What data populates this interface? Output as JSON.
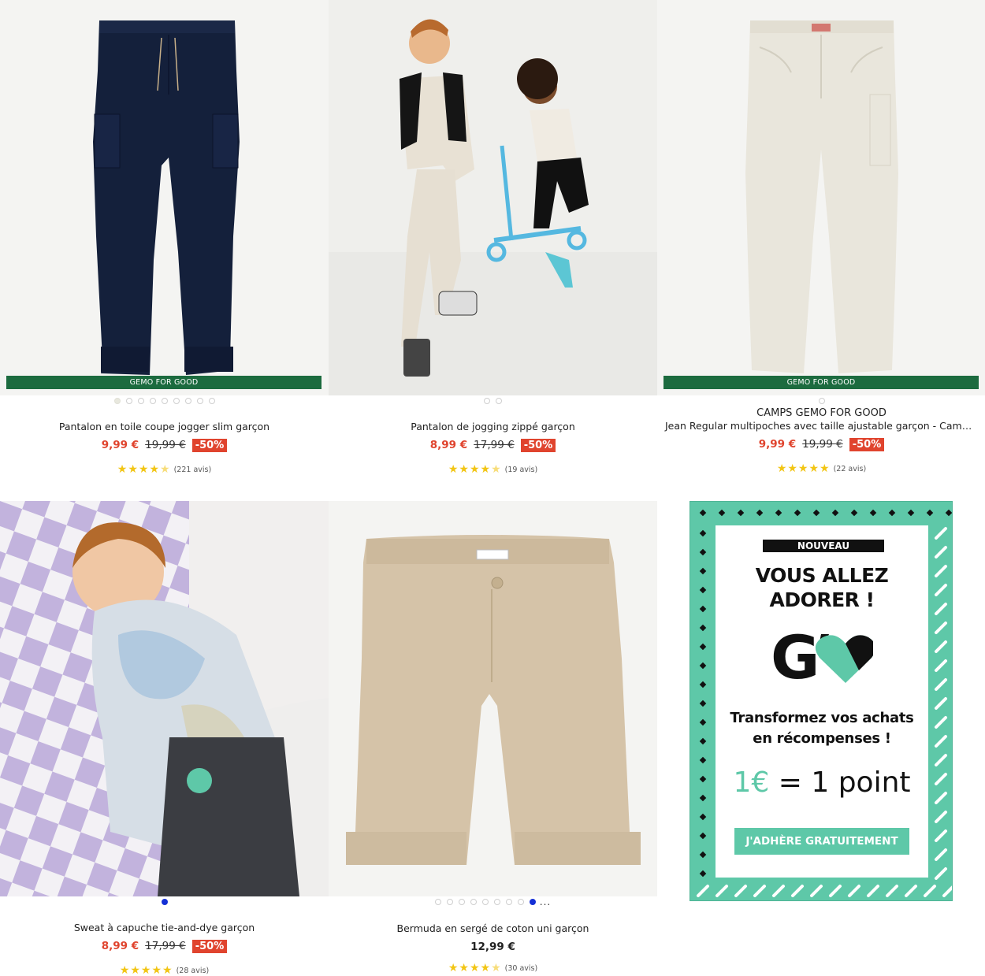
{
  "colors": {
    "sale": "#e0442e",
    "gemo_green": "#1c6b3f",
    "promo_mint": "#5ec8a8",
    "star": "#f2c514",
    "dot_active": "#1530d6"
  },
  "products": [
    {
      "badge": "GEMO FOR GOOD",
      "title": "Pantalon en toile coupe jogger slim garçon",
      "price": "9,99 €",
      "old_price": "19,99 €",
      "discount": "-50%",
      "stars": "★★★★★",
      "rating": 4.5,
      "reviews": "(221 avis)",
      "image_icon": "navy-jogger-pants"
    },
    {
      "title": "Pantalon de jogging zippé garçon",
      "price": "8,99 €",
      "old_price": "17,99 €",
      "discount": "-50%",
      "stars": "★★★★★",
      "rating": 4.5,
      "reviews": "(19 avis)",
      "image_icon": "kids-playing-photo"
    },
    {
      "badge": "GEMO FOR GOOD",
      "brand": "CAMPS GEMO FOR GOOD",
      "title": "Jean Regular multipoches avec taille ajustable garçon - Camps Uni...",
      "price": "9,99 €",
      "old_price": "19,99 €",
      "discount": "-50%",
      "stars": "★★★★★",
      "rating": 5,
      "reviews": "(22 avis)",
      "image_icon": "ecru-jeans"
    },
    {
      "title": "Sweat à capuche tie-and-dye garçon",
      "price": "8,99 €",
      "old_price": "17,99 €",
      "discount": "-50%",
      "stars": "★★★★★",
      "rating": 5,
      "reviews": "(28 avis)",
      "image_icon": "boy-tie-dye-hoodie-photo"
    },
    {
      "title": "Bermuda en sergé de coton uni garçon",
      "price": "12,99 €",
      "stars": "★★★★★",
      "rating": 4.5,
      "reviews": "(30 avis)",
      "dots_more": "...",
      "image_icon": "beige-bermuda-shorts"
    }
  ],
  "promo": {
    "tag": "NOUVEAU",
    "headline_1": "VOUS ALLEZ",
    "headline_2": "ADORER !",
    "logo_letter": "G",
    "logo_icon": "heart-icon",
    "sub_1": "Transformez vos achats",
    "sub_2": "en récompenses !",
    "rate_euro": "1€",
    "rate_eq": "=",
    "rate_point": "1 point",
    "button": "J'ADHÈRE GRATUITEMENT"
  }
}
